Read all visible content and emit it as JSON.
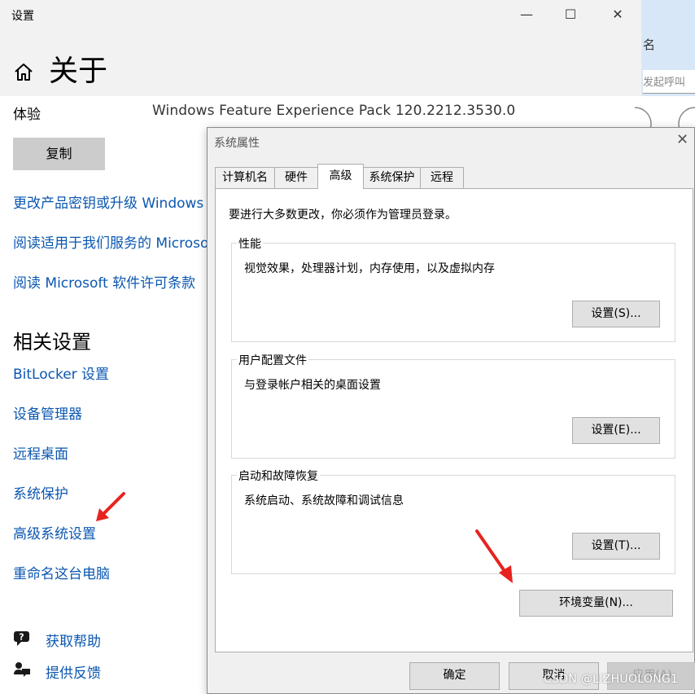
{
  "settings": {
    "window_title": "设置",
    "minimize": "—",
    "maximize": "☐",
    "close": "✕",
    "page_title": "关于",
    "experience_label": "体验",
    "experience_value": "Windows Feature Experience Pack 120.2212.3530.0",
    "copy_button": "复制",
    "links": [
      "更改产品密钥或升级 Windows",
      "阅读适用于我们服务的 Microso",
      "阅读 Microsoft 软件许可条款"
    ],
    "related_title": "相关设置",
    "related_links": [
      "BitLocker 设置",
      "设备管理器",
      "远程桌面",
      "系统保护",
      "高级系统设置",
      "重命名这台电脑"
    ],
    "help_link": "获取帮助",
    "feedback_link": "提供反馈"
  },
  "right_panel": {
    "label_fragment": "名",
    "input_placeholder": "发起呼叫"
  },
  "dialog": {
    "title": "系统属性",
    "close": "✕",
    "tabs": [
      "计算机名",
      "硬件",
      "高级",
      "系统保护",
      "远程"
    ],
    "active_tab": "高级",
    "intro": "要进行大多数更改，你必须作为管理员登录。",
    "performance": {
      "title": "性能",
      "desc": "视觉效果，处理器计划，内存使用，以及虚拟内存",
      "button": "设置(S)..."
    },
    "user_profiles": {
      "title": "用户配置文件",
      "desc": "与登录帐户相关的桌面设置",
      "button": "设置(E)..."
    },
    "startup_recovery": {
      "title": "启动和故障恢复",
      "desc": "系统启动、系统故障和调试信息",
      "button": "设置(T)..."
    },
    "env_button": "环境变量(N)...",
    "ok_button": "确定",
    "cancel_button": "取消",
    "apply_button": "应用(A)"
  },
  "watermark": "CSDN @LIZHUOLONG1",
  "colors": {
    "link": "#0b57b0",
    "annotation_arrow": "#e8231f",
    "dialog_bg": "#f0f0f0"
  }
}
